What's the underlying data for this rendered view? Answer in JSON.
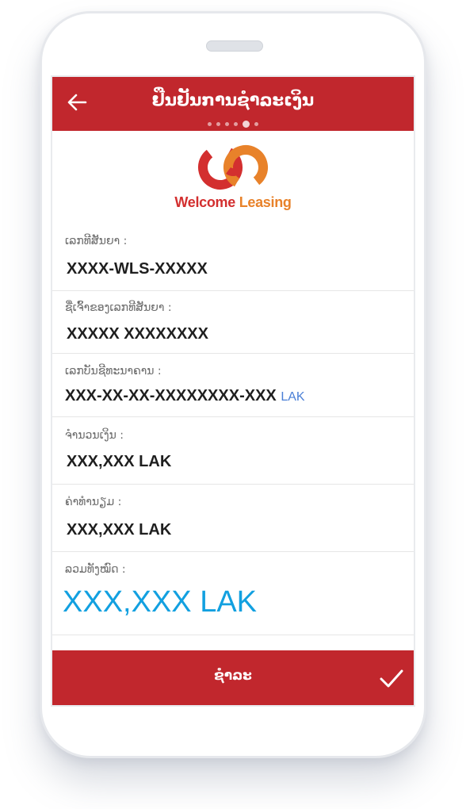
{
  "header": {
    "title": "ຢືນຢັນການຊຳລະເງິນ",
    "back_icon": "arrow-left-icon",
    "steps_total": 6,
    "step_current": 5
  },
  "logo": {
    "icon": "welcome-leasing-logo",
    "text_part1": "Welcome",
    "text_part2": "Leasing",
    "colors": {
      "red": "#d32f2f",
      "orange": "#e8822a"
    }
  },
  "fields": {
    "contract_number": {
      "label": "ເລກທີສັນຍາ :",
      "value": "XXXX-WLS-XXXXX"
    },
    "contract_owner": {
      "label": "ຊື່ເຈົ້າຂອງເລກທີສັນຍາ :",
      "value": "XXXXX  XXXXXXXX"
    },
    "bank_account": {
      "label": "ເລກບັນຊີທະນາຄານ :",
      "value": "XXX-XX-XX-XXXXXXXX-XXX",
      "currency": "LAK"
    },
    "loan_amount": {
      "label": "ຈຳນວນເງິນ :",
      "value": "XXX,XXX LAK"
    },
    "fee": {
      "label": "ຄ່າທຳນຽມ :",
      "value": "XXX,XXX LAK"
    },
    "total": {
      "label": "ລວມທັງໝົດ :",
      "amount": "XXX,XXX",
      "currency": "LAK"
    }
  },
  "footer": {
    "pay_label": "ຊຳລະ",
    "confirm_icon": "checkmark-icon"
  },
  "colors": {
    "brand_red": "#c1272d",
    "total_blue": "#12a0e0",
    "currency_blue": "#4a7fd6"
  }
}
